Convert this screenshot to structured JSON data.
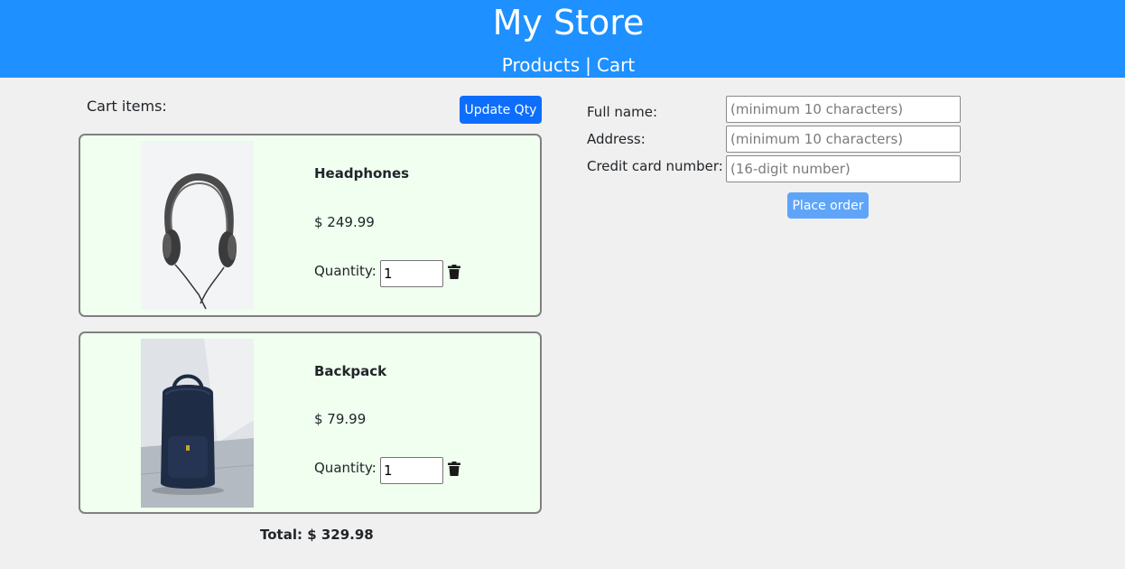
{
  "header": {
    "title": "My Store",
    "nav": [
      {
        "label": "Products"
      },
      {
        "label": "Cart"
      }
    ],
    "separator": "|",
    "background": "#1e90ff"
  },
  "cart": {
    "title": "Cart items:",
    "update_label": "Update Qty",
    "quantity_label": "Quantity:",
    "items": [
      {
        "name": "Headphones",
        "price": "$ 249.99",
        "quantity": "1",
        "image_icon": "headphones-image"
      },
      {
        "name": "Backpack",
        "price": "$ 79.99",
        "quantity": "1",
        "image_icon": "backpack-image"
      }
    ],
    "delete_icon": "trash-icon",
    "total": "Total: $ 329.98",
    "card_background": "#f0fff0"
  },
  "form": {
    "fields": [
      {
        "label": "Full name:",
        "placeholder": "(minimum 10 characters)",
        "value": ""
      },
      {
        "label": "Address:",
        "placeholder": "(minimum 10 characters)",
        "value": ""
      },
      {
        "label": "Credit card number:",
        "placeholder": "(16-digit number)",
        "value": ""
      }
    ],
    "submit_label": "Place order"
  },
  "colors": {
    "primary_button": "#0d6efd",
    "disabled_button": "#5ea5f9"
  }
}
